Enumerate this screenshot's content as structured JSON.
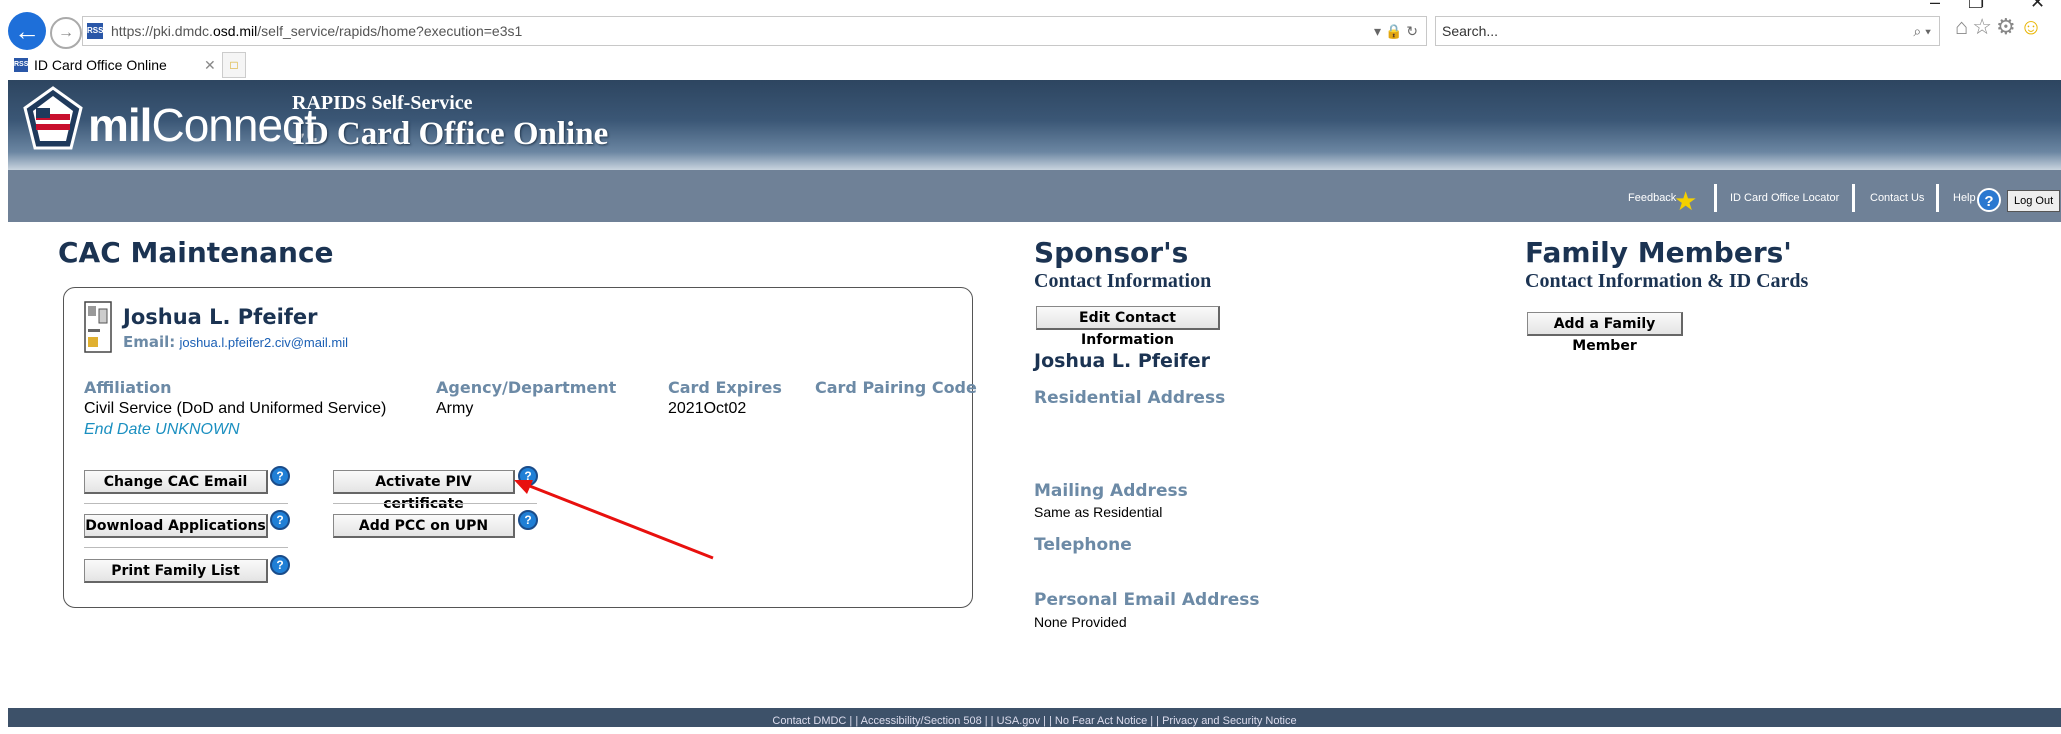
{
  "browser": {
    "url_prefix": "https://pki.dmdc.",
    "url_host": "osd.mil",
    "url_path": "/self_service/rapids/home?execution=e3s1",
    "search_placeholder": "Search...",
    "tab_title": "ID Card Office Online",
    "favicon": "RSS"
  },
  "header": {
    "logo_prefix": "mil",
    "logo_suffix": "Connect",
    "subtitle": "RAPIDS Self-Service",
    "title": "ID Card Office Online"
  },
  "navbar": {
    "feedback": "Feedback",
    "locator": "ID Card Office Locator",
    "contact": "Contact Us",
    "help": "Help",
    "logout": "Log Out"
  },
  "cac": {
    "heading": "CAC Maintenance",
    "name": "Joshua L. Pfeifer",
    "email_label": "Email:",
    "email": "joshua.l.pfeifer2.civ@mail.mil",
    "columns": {
      "affiliation_label": "Affiliation",
      "affiliation": "Civil Service (DoD and Uniformed Service)",
      "end_date": "End Date  UNKNOWN",
      "agency_label": "Agency/Department",
      "agency": "Army",
      "expires_label": "Card Expires",
      "expires": "2021Oct02",
      "pairing_label": "Card Pairing Code"
    },
    "buttons": {
      "change_email": "Change CAC Email",
      "activate_piv": "Activate PIV certificate",
      "download_apps": "Download Applications",
      "add_pcc": "Add PCC on UPN",
      "print_family": "Print Family List"
    },
    "help_glyph": "?"
  },
  "sponsor": {
    "heading": "Sponsor's",
    "subheading": "Contact Information",
    "edit_button": "Edit Contact Information",
    "name": "Joshua L. Pfeifer",
    "residential_label": "Residential Address",
    "mailing_label": "Mailing Address",
    "mailing_value": "Same as Residential",
    "telephone_label": "Telephone",
    "email_label": "Personal Email Address",
    "email_value": "None Provided"
  },
  "family": {
    "heading": "Family Members'",
    "subheading": "Contact Information & ID Cards",
    "add_button": "Add a Family Member"
  },
  "footer": {
    "links": "Contact DMDC  |  |  Accessibility/Section 508  |  |  USA.gov  |  |  No Fear Act Notice  |  |  Privacy and Security Notice"
  },
  "colors": {
    "heading": "#1b3352",
    "label": "#6c8aa6",
    "link": "#1a5fb4",
    "arrow": "#e8100e"
  }
}
